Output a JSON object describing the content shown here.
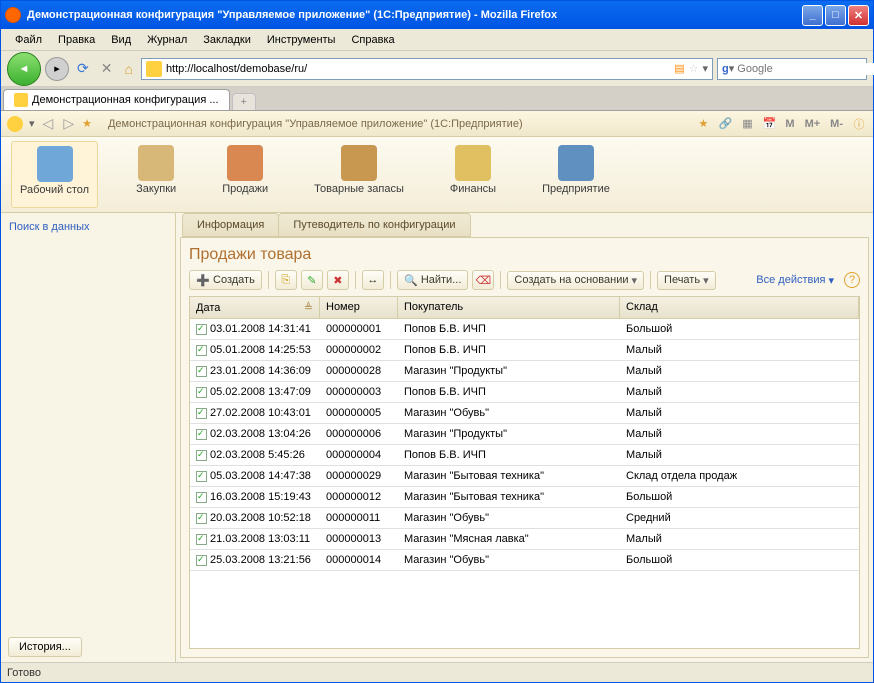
{
  "window": {
    "title": "Демонстрационная конфигурация \"Управляемое приложение\" (1С:Предприятие) - Mozilla Firefox"
  },
  "menu": {
    "file": "Файл",
    "edit": "Правка",
    "view": "Вид",
    "history": "Журнал",
    "bookmarks": "Закладки",
    "tools": "Инструменты",
    "help": "Справка"
  },
  "nav": {
    "url": "http://localhost/demobase/ru/",
    "search_placeholder": "Google"
  },
  "tab": {
    "label": "Демонстрационная конфигурация ..."
  },
  "app": {
    "breadcrumb": "Демонстрационная конфигурация \"Управляемое приложение\" (1С:Предприятие)",
    "m": "M",
    "m_plus": "M+",
    "m_minus": "M-"
  },
  "sections": {
    "desktop": "Рабочий стол",
    "purchases": "Закупки",
    "sales": "Продажи",
    "stock": "Товарные запасы",
    "finance": "Финансы",
    "enterprise": "Предприятие"
  },
  "leftpanel": {
    "search_link": "Поиск в данных"
  },
  "subtabs": {
    "info": "Информация",
    "guide": "Путеводитель по конфигурации"
  },
  "page": {
    "title": "Продажи товара",
    "btn_create": "Создать",
    "btn_find": "Найти...",
    "btn_create_based": "Создать на основании",
    "btn_print": "Печать",
    "btn_all_actions": "Все действия"
  },
  "grid": {
    "col_date": "Дата",
    "col_num": "Номер",
    "col_buyer": "Покупатель",
    "col_wh": "Склад",
    "rows": [
      {
        "date": "03.01.2008 14:31:41",
        "num": "000000001",
        "buyer": "Попов Б.В. ИЧП",
        "wh": "Большой"
      },
      {
        "date": "05.01.2008 14:25:53",
        "num": "000000002",
        "buyer": "Попов Б.В. ИЧП",
        "wh": "Малый"
      },
      {
        "date": "23.01.2008 14:36:09",
        "num": "000000028",
        "buyer": "Магазин \"Продукты\"",
        "wh": "Малый"
      },
      {
        "date": "05.02.2008 13:47:09",
        "num": "000000003",
        "buyer": "Попов Б.В. ИЧП",
        "wh": "Малый"
      },
      {
        "date": "27.02.2008 10:43:01",
        "num": "000000005",
        "buyer": "Магазин \"Обувь\"",
        "wh": "Малый"
      },
      {
        "date": "02.03.2008 13:04:26",
        "num": "000000006",
        "buyer": "Магазин \"Продукты\"",
        "wh": "Малый"
      },
      {
        "date": "02.03.2008 5:45:26",
        "num": "000000004",
        "buyer": "Попов Б.В. ИЧП",
        "wh": "Малый"
      },
      {
        "date": "05.03.2008 14:47:38",
        "num": "000000029",
        "buyer": "Магазин \"Бытовая техника\"",
        "wh": "Склад отдела продаж"
      },
      {
        "date": "16.03.2008 15:19:43",
        "num": "000000012",
        "buyer": "Магазин \"Бытовая техника\"",
        "wh": "Большой"
      },
      {
        "date": "20.03.2008 10:52:18",
        "num": "000000011",
        "buyer": "Магазин \"Обувь\"",
        "wh": "Средний"
      },
      {
        "date": "21.03.2008 13:03:11",
        "num": "000000013",
        "buyer": "Магазин \"Мясная лавка\"",
        "wh": "Малый"
      },
      {
        "date": "25.03.2008 13:21:56",
        "num": "000000014",
        "buyer": "Магазин \"Обувь\"",
        "wh": "Большой"
      }
    ]
  },
  "history_btn": "История...",
  "status": "Готово",
  "icon_colors": {
    "desktop": "#6fa8d8",
    "purchases": "#d8b878",
    "sales": "#d88850",
    "stock": "#c89850",
    "finance": "#e0c060",
    "enterprise": "#6090c0"
  }
}
